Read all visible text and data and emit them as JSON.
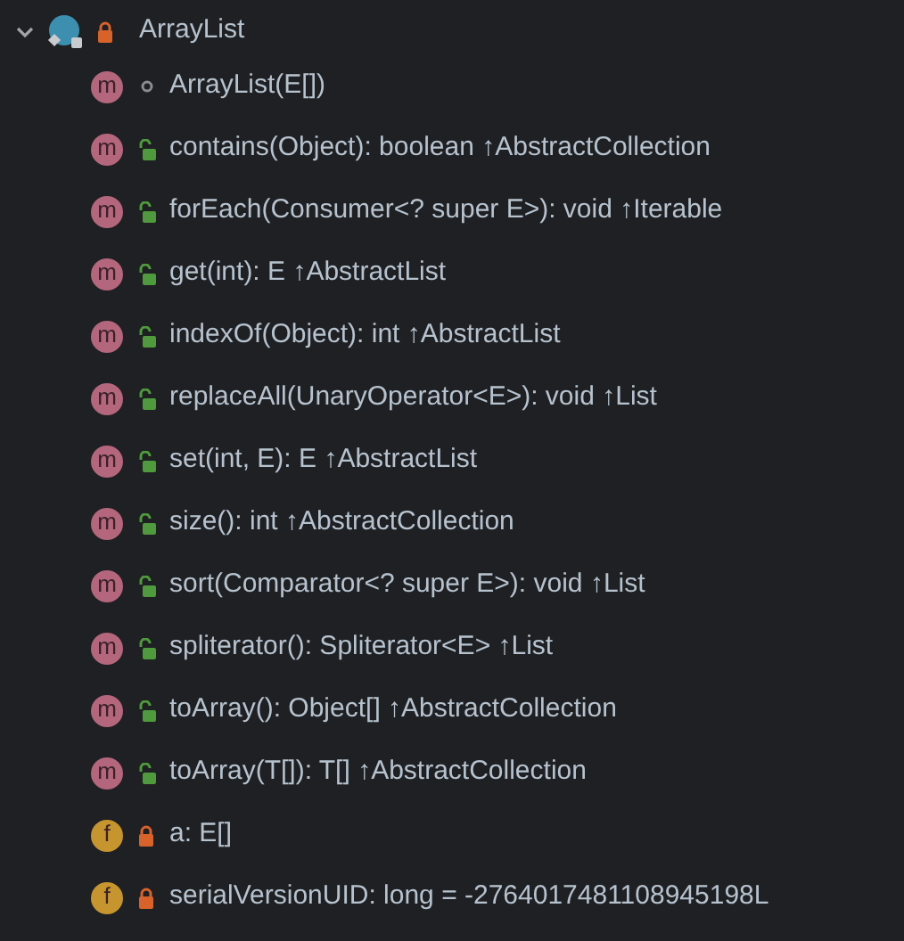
{
  "tree": {
    "label": "ArrayList",
    "access": {
      "kind": "private"
    },
    "expanded": true,
    "children": [
      {
        "kind": "method",
        "badge": "m",
        "access": {
          "kind": "package"
        },
        "signature": "ArrayList(E[])"
      },
      {
        "kind": "method",
        "badge": "m",
        "access": {
          "kind": "public"
        },
        "signature": "contains(Object): boolean",
        "origin": "↑AbstractCollection"
      },
      {
        "kind": "method",
        "badge": "m",
        "access": {
          "kind": "public"
        },
        "signature": "forEach(Consumer<? super E>): void",
        "origin": "↑Iterable"
      },
      {
        "kind": "method",
        "badge": "m",
        "access": {
          "kind": "public"
        },
        "signature": "get(int): E",
        "origin": "↑AbstractList"
      },
      {
        "kind": "method",
        "badge": "m",
        "access": {
          "kind": "public"
        },
        "signature": "indexOf(Object): int",
        "origin": "↑AbstractList"
      },
      {
        "kind": "method",
        "badge": "m",
        "access": {
          "kind": "public"
        },
        "signature": "replaceAll(UnaryOperator<E>): void",
        "origin": "↑List"
      },
      {
        "kind": "method",
        "badge": "m",
        "access": {
          "kind": "public"
        },
        "signature": "set(int, E): E",
        "origin": "↑AbstractList"
      },
      {
        "kind": "method",
        "badge": "m",
        "access": {
          "kind": "public"
        },
        "signature": "size(): int",
        "origin": "↑AbstractCollection"
      },
      {
        "kind": "method",
        "badge": "m",
        "access": {
          "kind": "public"
        },
        "signature": "sort(Comparator<? super E>): void",
        "origin": "↑List"
      },
      {
        "kind": "method",
        "badge": "m",
        "access": {
          "kind": "public"
        },
        "signature": "spliterator(): Spliterator<E>",
        "origin": "↑List"
      },
      {
        "kind": "method",
        "badge": "m",
        "access": {
          "kind": "public"
        },
        "signature": "toArray(): Object[]",
        "origin": "↑AbstractCollection"
      },
      {
        "kind": "method",
        "badge": "m",
        "access": {
          "kind": "public"
        },
        "signature": "toArray(T[]): T[]",
        "origin": "↑AbstractCollection"
      },
      {
        "kind": "field",
        "badge": "f",
        "access": {
          "kind": "private"
        },
        "signature": "a: E[]"
      },
      {
        "kind": "field",
        "badge": "f",
        "access": {
          "kind": "private"
        },
        "signature": "serialVersionUID: long = -2764017481108945198L"
      }
    ]
  }
}
